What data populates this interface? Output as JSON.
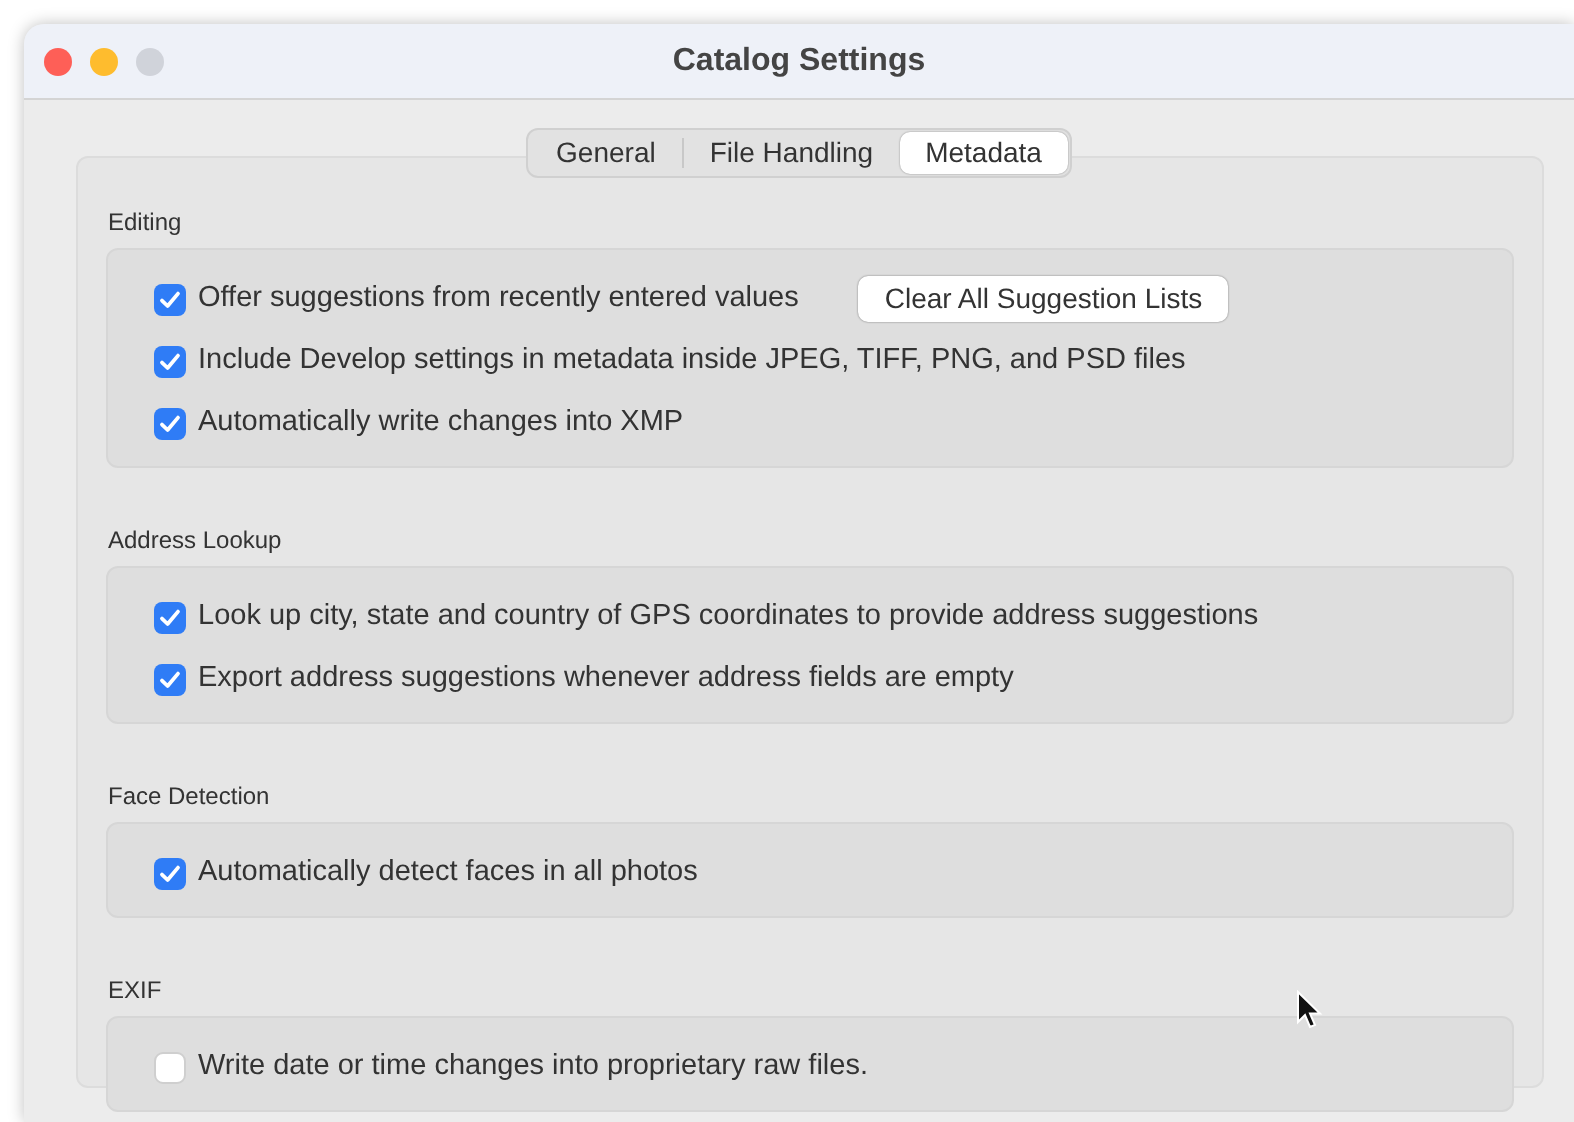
{
  "window": {
    "title": "Catalog Settings"
  },
  "tabs": [
    {
      "label": "General",
      "selected": false
    },
    {
      "label": "File Handling",
      "selected": false
    },
    {
      "label": "Metadata",
      "selected": true
    }
  ],
  "sections": [
    {
      "title": "Editing",
      "options": [
        {
          "label": "Offer suggestions from recently entered values",
          "checked": true,
          "button": "Clear All Suggestion Lists"
        },
        {
          "label": "Include Develop settings in metadata inside JPEG, TIFF, PNG, and PSD files",
          "checked": true
        },
        {
          "label": "Automatically write changes into XMP",
          "checked": true
        }
      ]
    },
    {
      "title": "Address Lookup",
      "options": [
        {
          "label": "Look up city, state and country of GPS coordinates to provide address suggestions",
          "checked": true
        },
        {
          "label": "Export address suggestions whenever address fields are empty",
          "checked": true
        }
      ]
    },
    {
      "title": "Face Detection",
      "options": [
        {
          "label": "Automatically detect faces in all photos",
          "checked": true
        }
      ]
    },
    {
      "title": "EXIF",
      "options": [
        {
          "label": "Write date or time changes into proprietary raw files.",
          "checked": false
        }
      ]
    }
  ]
}
